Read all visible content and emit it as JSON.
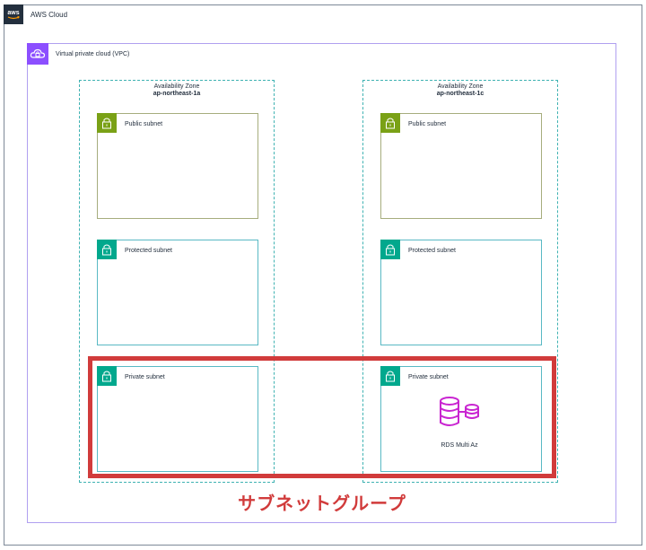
{
  "cloud": {
    "label": "AWS Cloud",
    "logo_icon": "aws-logo-icon"
  },
  "vpc": {
    "label": "Virtual private cloud (VPC)",
    "icon": "vpc-cloud-icon"
  },
  "zones": [
    {
      "title": "Availability Zone",
      "name": "ap-northeast-1a",
      "subnets": {
        "public": "Public subnet",
        "protected": "Protected subnet",
        "private": "Private subnet"
      }
    },
    {
      "title": "Availability Zone",
      "name": "ap-northeast-1c",
      "subnets": {
        "public": "Public subnet",
        "protected": "Protected subnet",
        "private": "Private subnet"
      }
    }
  ],
  "rds": {
    "label": "RDS Multi Az",
    "icon": "rds-multi-az-icon"
  },
  "subnet_group": {
    "label": "サブネットグループ"
  },
  "colors": {
    "cloud_border": "#7d8998",
    "vpc_accent": "#8c4fff",
    "public_lock": "#7aa116",
    "private_lock": "#01a88d",
    "az_border": "#3fb2b2",
    "highlight": "#d13b3b",
    "rds": "#c925d1"
  }
}
